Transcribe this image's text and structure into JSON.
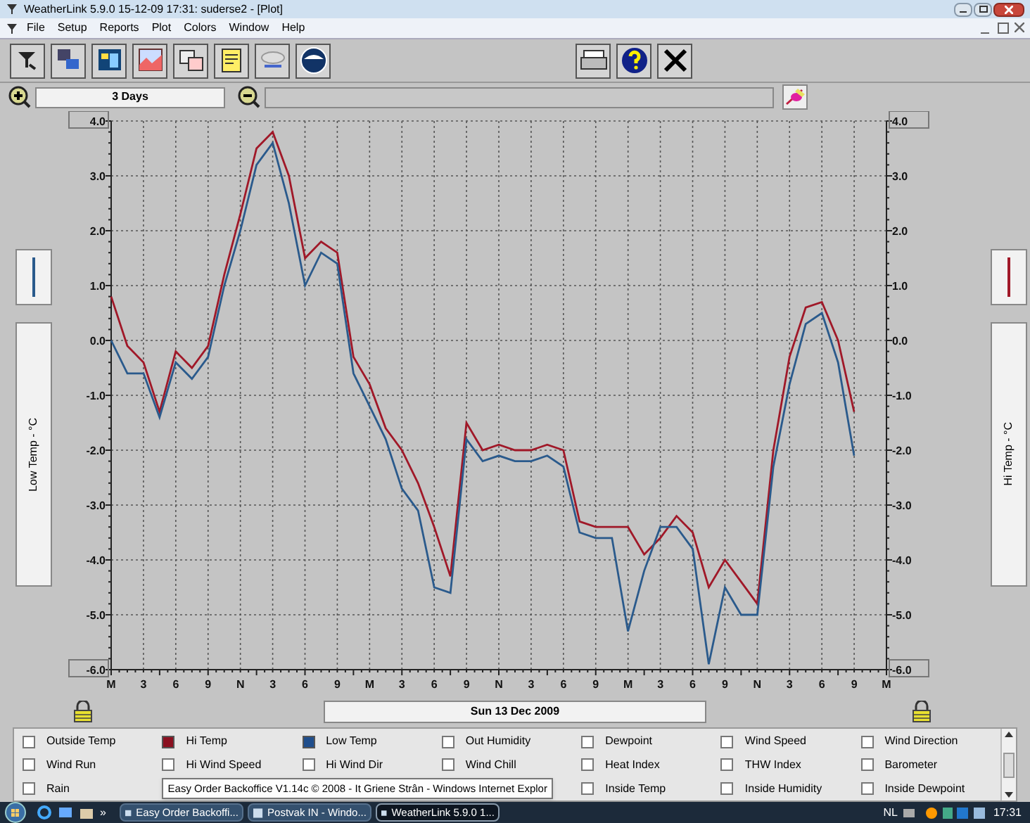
{
  "window": {
    "title": "WeatherLink 5.9.0  15-12-09  17:31: suderse2 - [Plot]"
  },
  "menu": [
    "File",
    "Setup",
    "Reports",
    "Plot",
    "Colors",
    "Window",
    "Help"
  ],
  "range": {
    "value": "3 Days"
  },
  "plot": {
    "left_label": "Low Temp - °C",
    "right_label": "Hi Temp - °C",
    "date": "Sun 13 Dec 2009",
    "chart_data": {
      "type": "line",
      "categories": [
        "M",
        null,
        "3",
        null,
        "6",
        null,
        "9",
        null,
        "N",
        null,
        "3",
        null,
        "6",
        null,
        "9",
        null,
        "M",
        null,
        "3",
        null,
        "6",
        null,
        "9",
        null,
        "N",
        null,
        "3",
        null,
        "6",
        null,
        "9",
        null,
        "M",
        null,
        "3",
        null,
        "6",
        null,
        "9",
        null,
        "N",
        null,
        "3",
        null,
        "6",
        null,
        "9",
        null,
        "M"
      ],
      "series": [
        {
          "color": "#a01828",
          "values": [
            0.8,
            -0.1,
            -0.4,
            -1.3,
            -0.2,
            -0.5,
            -0.1,
            1.2,
            2.3,
            3.5,
            3.8,
            3.0,
            1.5,
            1.8,
            1.6,
            -0.3,
            -0.8,
            -1.6,
            -2.0,
            -2.6,
            -3.4,
            -4.3,
            -1.5,
            -2.0,
            -1.9,
            -2.0,
            -2.0,
            -1.9,
            -2.0,
            -3.3,
            -3.4,
            -3.4,
            -3.4,
            -3.9,
            -3.6,
            -3.2,
            -3.5,
            -4.5,
            -4.0,
            -4.4,
            -4.8,
            -2.0,
            -0.3,
            0.6,
            0.7,
            0.0,
            -1.3,
            null,
            null
          ]
        },
        {
          "color": "#2a5a8c",
          "values": [
            0.0,
            -0.6,
            -0.6,
            -1.4,
            -0.4,
            -0.7,
            -0.3,
            1.0,
            2.0,
            3.2,
            3.6,
            2.5,
            1.0,
            1.6,
            1.4,
            -0.6,
            -1.2,
            -1.8,
            -2.7,
            -3.1,
            -4.5,
            -4.6,
            -1.8,
            -2.2,
            -2.1,
            -2.2,
            -2.2,
            -2.1,
            -2.3,
            -3.5,
            -3.6,
            -3.6,
            -5.3,
            -4.2,
            -3.4,
            -3.4,
            -3.8,
            -5.9,
            -4.5,
            -5.0,
            -5.0,
            -2.3,
            -0.8,
            0.3,
            0.5,
            -0.4,
            -2.1,
            null,
            null
          ]
        }
      ],
      "ylim": [
        -6,
        4
      ],
      "grid": true,
      "yticks": [
        {
          "value": 4,
          "label": "4.0"
        },
        {
          "value": 3,
          "label": "3.0"
        },
        {
          "value": 2,
          "label": "2.0"
        },
        {
          "value": 1,
          "label": "1.0"
        },
        {
          "value": 0,
          "label": "0.0"
        },
        {
          "value": -1,
          "label": "-1.0"
        },
        {
          "value": -2,
          "label": "-2.0"
        },
        {
          "value": -3,
          "label": "-3.0"
        },
        {
          "value": -4,
          "label": "-4.0"
        },
        {
          "value": -5,
          "label": "-5.0"
        },
        {
          "value": -6,
          "label": "-6.0"
        }
      ]
    }
  },
  "fields": [
    {
      "label": "Outside Temp",
      "checked": false
    },
    {
      "label": "Hi Temp",
      "checked": true,
      "color": "#8b1020"
    },
    {
      "label": "Low Temp",
      "checked": true,
      "color": "#1f4e8c"
    },
    {
      "label": "Out Humidity",
      "checked": false
    },
    {
      "label": "Dewpoint",
      "checked": false
    },
    {
      "label": "Wind Speed",
      "checked": false
    },
    {
      "label": "Wind Direction",
      "checked": false
    },
    {
      "label": "Wind Run",
      "checked": false
    },
    {
      "label": "Hi Wind Speed",
      "checked": false
    },
    {
      "label": "Hi Wind Dir",
      "checked": false
    },
    {
      "label": "Wind Chill",
      "checked": false
    },
    {
      "label": "Heat Index",
      "checked": false
    },
    {
      "label": "THW Index",
      "checked": false
    },
    {
      "label": "Barometer",
      "checked": false
    },
    {
      "label": "Rain",
      "checked": false
    },
    {
      "kind": "tooltip",
      "label": "Easy Order Backoffice V1.14c © 2008 - It Griene Strân - Windows Internet Explor"
    },
    {
      "label": "Inside Temp",
      "checked": false
    },
    {
      "label": "Inside Humidity",
      "checked": false
    },
    {
      "label": "Inside Dewpoint",
      "checked": false
    }
  ],
  "taskbar": {
    "overflow": "»",
    "tasks": [
      {
        "label": "Easy Order Backoffi...",
        "selected": false
      },
      {
        "label": "Postvak IN - Windo...",
        "selected": false
      },
      {
        "label": "WeatherLink 5.9.0  1...",
        "selected": true
      }
    ],
    "language": "NL",
    "clock": "17:31"
  }
}
